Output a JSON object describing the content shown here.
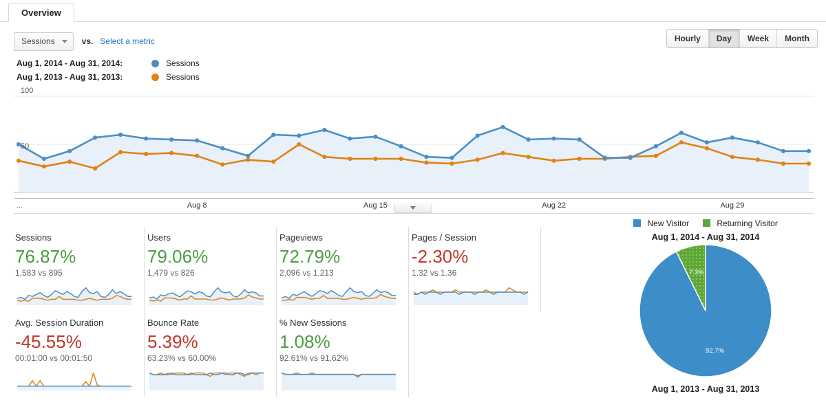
{
  "tab": {
    "label": "Overview"
  },
  "controls": {
    "metric_select": {
      "value": "Sessions",
      "caret_icon": "chevron-down-icon"
    },
    "vs_label": "vs.",
    "select_metric_link": "Select a metric",
    "granularity": {
      "options": [
        "Hourly",
        "Day",
        "Week",
        "Month"
      ],
      "selected": "Day"
    }
  },
  "legend": {
    "rows": [
      {
        "range": "Aug 1, 2014 - Aug 31, 2014:",
        "series": "Sessions",
        "color": "#4a8fc4"
      },
      {
        "range": "Aug 1, 2013 - Aug 31, 2013:",
        "series": "Sessions",
        "color": "#e08214"
      }
    ]
  },
  "colors": {
    "current_blue": "#4a8fc4",
    "previous_orange": "#e08214",
    "area_fill": "#e8f1f9",
    "positive_green": "#4a9e3f",
    "negative_red": "#c0392b",
    "pie_blue": "#3c8dc8",
    "pie_green": "#5aa83c"
  },
  "chart_data": {
    "type": "line",
    "title": "Sessions over time",
    "xlabel": "",
    "ylabel": "Sessions",
    "ylim": [
      0,
      100
    ],
    "yticks": [
      50,
      100
    ],
    "grid": true,
    "legend_position": "above",
    "x_tick_labels": [
      "...",
      "Aug 8",
      "Aug 15",
      "Aug 22",
      "Aug 29"
    ],
    "x_tick_indices": [
      0,
      7,
      14,
      21,
      28
    ],
    "x": [
      "Aug 1",
      "Aug 2",
      "Aug 3",
      "Aug 4",
      "Aug 5",
      "Aug 6",
      "Aug 7",
      "Aug 8",
      "Aug 9",
      "Aug 10",
      "Aug 11",
      "Aug 12",
      "Aug 13",
      "Aug 14",
      "Aug 15",
      "Aug 16",
      "Aug 17",
      "Aug 18",
      "Aug 19",
      "Aug 20",
      "Aug 21",
      "Aug 22",
      "Aug 23",
      "Aug 24",
      "Aug 25",
      "Aug 26",
      "Aug 27",
      "Aug 28",
      "Aug 29",
      "Aug 30",
      "Aug 31"
    ],
    "series": [
      {
        "name": "Sessions (Aug 1, 2014 - Aug 31, 2014)",
        "color": "#4a8fc4",
        "values": [
          50,
          35,
          43,
          57,
          60,
          56,
          55,
          54,
          46,
          38,
          60,
          59,
          65,
          56,
          58,
          48,
          37,
          36,
          59,
          68,
          55,
          56,
          55,
          36,
          36,
          48,
          62,
          52,
          57,
          52,
          43,
          43
        ]
      },
      {
        "name": "Sessions (Aug 1, 2013 - Aug 31, 2013)",
        "color": "#e08214",
        "values": [
          33,
          27,
          32,
          25,
          42,
          40,
          41,
          38,
          29,
          34,
          32,
          50,
          37,
          35,
          35,
          35,
          31,
          30,
          34,
          41,
          37,
          33,
          35,
          35,
          37,
          38,
          52,
          46,
          37,
          34,
          30,
          30
        ]
      }
    ]
  },
  "metric_cards": [
    {
      "title": "Sessions",
      "percent": "76.87%",
      "direction": "up",
      "comparison": "1,583 vs 895",
      "spark_current": [
        5,
        6,
        4,
        8,
        7,
        9,
        11,
        8,
        6,
        9,
        13,
        11,
        9,
        12,
        10,
        7,
        6,
        12,
        16,
        11,
        10,
        12,
        7,
        6,
        9,
        14,
        10,
        12,
        10,
        7,
        7
      ],
      "spark_previous": [
        3,
        2,
        3,
        2,
        5,
        5,
        5,
        4,
        3,
        4,
        4,
        7,
        4,
        4,
        4,
        4,
        3,
        3,
        4,
        5,
        4,
        3,
        4,
        4,
        4,
        5,
        8,
        7,
        5,
        4,
        4
      ]
    },
    {
      "title": "Users",
      "percent": "79.06%",
      "direction": "up",
      "comparison": "1,479 vs 826",
      "spark_current": [
        5,
        6,
        4,
        8,
        7,
        9,
        10,
        8,
        6,
        9,
        12,
        11,
        9,
        11,
        10,
        7,
        6,
        11,
        15,
        11,
        10,
        11,
        7,
        6,
        9,
        13,
        10,
        11,
        10,
        7,
        7
      ],
      "spark_previous": [
        3,
        2,
        3,
        2,
        5,
        5,
        5,
        4,
        3,
        4,
        4,
        7,
        4,
        4,
        4,
        4,
        3,
        3,
        4,
        5,
        4,
        3,
        4,
        4,
        4,
        5,
        8,
        6,
        5,
        4,
        4
      ]
    },
    {
      "title": "Pageviews",
      "percent": "72.79%",
      "direction": "up",
      "comparison": "2,096 vs 1,213",
      "spark_current": [
        5,
        7,
        5,
        9,
        8,
        10,
        12,
        9,
        7,
        10,
        13,
        12,
        10,
        13,
        11,
        8,
        7,
        12,
        16,
        12,
        11,
        12,
        8,
        7,
        10,
        14,
        11,
        12,
        11,
        8,
        8
      ],
      "spark_previous": [
        3,
        3,
        4,
        3,
        6,
        6,
        6,
        5,
        4,
        5,
        5,
        8,
        5,
        5,
        5,
        5,
        4,
        4,
        5,
        6,
        5,
        4,
        5,
        5,
        5,
        6,
        9,
        7,
        6,
        5,
        5
      ]
    },
    {
      "title": "Pages / Session",
      "percent": "-2.30%",
      "direction": "down",
      "comparison": "1.32 vs 1.36",
      "spark_current": [
        4,
        4,
        5,
        4,
        5,
        5,
        5,
        4,
        5,
        5,
        5,
        5,
        4,
        5,
        5,
        5,
        4,
        5,
        5,
        5,
        5,
        4,
        5,
        5,
        5,
        5,
        5,
        5,
        5,
        4,
        5
      ],
      "spark_previous": [
        5,
        4,
        5,
        5,
        5,
        6,
        5,
        5,
        5,
        5,
        5,
        6,
        5,
        5,
        5,
        5,
        5,
        5,
        5,
        6,
        5,
        5,
        5,
        5,
        5,
        7,
        6,
        5,
        5,
        5,
        5
      ]
    },
    {
      "title": "Avg. Session Duration",
      "percent": "-45.55%",
      "direction": "down",
      "comparison": "00:01:00 vs 00:01:50",
      "spark_current": [
        2,
        2,
        2,
        2,
        2,
        2,
        2,
        2,
        2,
        2,
        2,
        2,
        2,
        2,
        2,
        2,
        2,
        2,
        2,
        2,
        2,
        2,
        2,
        2,
        2,
        2,
        2,
        2,
        2,
        2,
        2
      ],
      "spark_previous": [
        2,
        2,
        2,
        2,
        7,
        2,
        7,
        2,
        2,
        2,
        2,
        2,
        2,
        2,
        2,
        2,
        2,
        2,
        6,
        2,
        14,
        3,
        2,
        2,
        2,
        2,
        2,
        2,
        2,
        2,
        2
      ]
    },
    {
      "title": "Bounce Rate",
      "percent": "5.39%",
      "direction": "down",
      "comparison": "63.23% vs 60.00%",
      "spark_current": [
        9,
        8,
        8,
        8,
        8,
        8,
        9,
        8,
        8,
        8,
        8,
        9,
        8,
        8,
        8,
        8,
        9,
        8,
        8,
        9,
        9,
        8,
        8,
        9,
        9,
        8,
        8,
        9,
        9,
        9,
        9
      ],
      "spark_previous": [
        9,
        8,
        8,
        9,
        8,
        9,
        8,
        9,
        9,
        9,
        8,
        8,
        9,
        9,
        9,
        8,
        7,
        9,
        9,
        9,
        8,
        9,
        9,
        9,
        8,
        7,
        9,
        9,
        8,
        9,
        9
      ]
    },
    {
      "title": "% New Sessions",
      "percent": "1.08%",
      "direction": "up",
      "comparison": "92.61% vs 91.62%",
      "spark_current": [
        11,
        10,
        10,
        10,
        10,
        10,
        10,
        10,
        10,
        10,
        10,
        10,
        10,
        10,
        10,
        10,
        10,
        10,
        10,
        10,
        9,
        10,
        10,
        10,
        10,
        10,
        10,
        10,
        10,
        10,
        10
      ],
      "spark_previous": [
        11,
        10,
        10,
        10,
        11,
        10,
        10,
        10,
        11,
        10,
        10,
        10,
        10,
        10,
        10,
        10,
        10,
        10,
        10,
        10,
        8,
        10,
        10,
        10,
        10,
        10,
        10,
        10,
        10,
        10,
        10
      ]
    }
  ],
  "pie": {
    "legend": [
      {
        "label": "New Visitor",
        "color": "#3c8dc8"
      },
      {
        "label": "Returning Visitor",
        "color": "#5aa83c"
      }
    ],
    "caption_top": "Aug 1, 2014 - Aug 31, 2014",
    "caption_bottom": "Aug 1, 2013 - Aug 31, 2013",
    "chart_data": {
      "type": "pie",
      "title": "Aug 1, 2014 - Aug 31, 2014",
      "labels": [
        "New Visitor",
        "Returning Visitor"
      ],
      "values": [
        92.7,
        7.3
      ],
      "value_labels": [
        "92.7%",
        "7.3%"
      ],
      "colors": [
        "#3c8dc8",
        "#5aa83c"
      ]
    }
  }
}
